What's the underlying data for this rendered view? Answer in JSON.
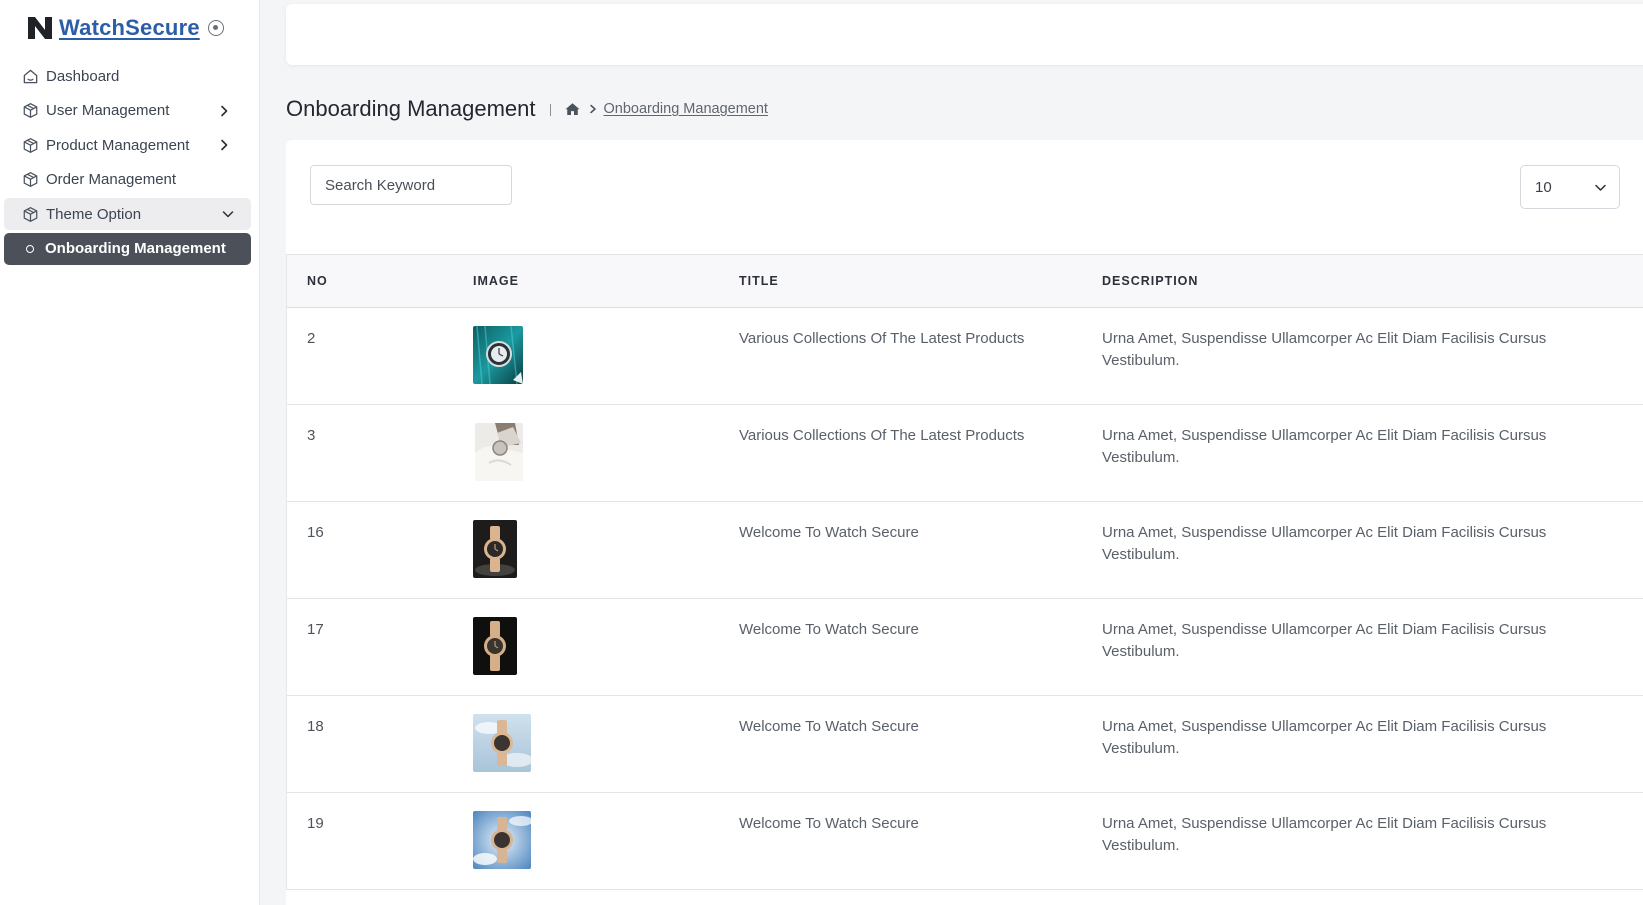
{
  "brand": {
    "name": "WatchSecure"
  },
  "sidebar": {
    "items": [
      {
        "label": "Dashboard",
        "icon": "home-outline-icon"
      },
      {
        "label": "User Management",
        "icon": "box-icon",
        "chevron": "right"
      },
      {
        "label": "Product Management",
        "icon": "box-icon",
        "chevron": "right"
      },
      {
        "label": "Order Management",
        "icon": "box-icon"
      },
      {
        "label": "Theme Option",
        "icon": "box-icon",
        "chevron": "down"
      },
      {
        "label": "Onboarding Management",
        "icon": "circle-dot-icon",
        "active": true
      }
    ]
  },
  "header": {
    "title": "Onboarding Management",
    "breadcrumb": {
      "current": "Onboarding Management"
    }
  },
  "toolbar": {
    "search_placeholder": "Search Keyword",
    "page_size": "10"
  },
  "table": {
    "columns": [
      "NO",
      "IMAGE",
      "TITLE",
      "DESCRIPTION"
    ],
    "rows": [
      {
        "no": "2",
        "image": "teal-watch",
        "title": "Various Collections Of The Latest Products",
        "description": "Urna Amet, Suspendisse Ullamcorper Ac Elit Diam Facilisis Cursus Vestibulum."
      },
      {
        "no": "3",
        "image": "white-sleeve-watch",
        "title": "Various Collections Of The Latest Products",
        "description": "Urna Amet, Suspendisse Ullamcorper Ac Elit Diam Facilisis Cursus Vestibulum."
      },
      {
        "no": "16",
        "image": "dark-gold-watch",
        "title": "Welcome To Watch Secure",
        "description": "Urna Amet, Suspendisse Ullamcorper Ac Elit Diam Facilisis Cursus Vestibulum."
      },
      {
        "no": "17",
        "image": "black-gold-watch",
        "title": "Welcome To Watch Secure",
        "description": "Urna Amet, Suspendisse Ullamcorper Ac Elit Diam Facilisis Cursus Vestibulum."
      },
      {
        "no": "18",
        "image": "sky-gold-watch",
        "title": "Welcome To Watch Secure",
        "description": "Urna Amet, Suspendisse Ullamcorper Ac Elit Diam Facilisis Cursus Vestibulum."
      },
      {
        "no": "19",
        "image": "blue-sky-watch",
        "title": "Welcome To Watch Secure",
        "description": "Urna Amet, Suspendisse Ullamcorper Ac Elit Diam Facilisis Cursus Vestibulum."
      }
    ]
  },
  "colors": {
    "brand": "#2c5ea8",
    "active_nav": "#4b5059",
    "background": "#f4f5f7"
  }
}
